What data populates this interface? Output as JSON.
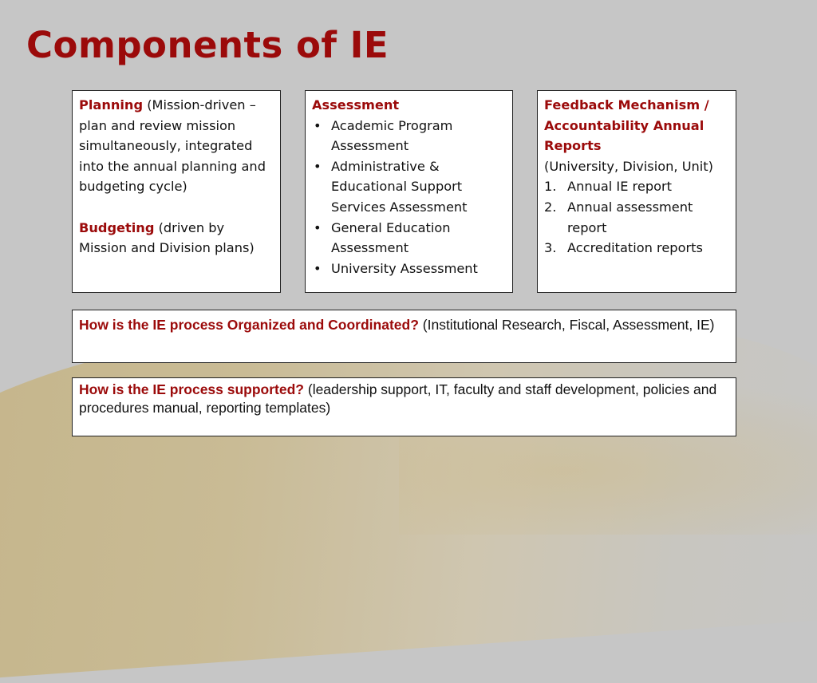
{
  "title": "Components of IE",
  "colors": {
    "accent": "#9b0a0a",
    "background": "#c6c6c6",
    "box": "#ffffff"
  },
  "planning_box": {
    "planning_heading": "Planning",
    "planning_text": " (Mission-driven – plan and review mission simultaneously, integrated into the annual planning and budgeting cycle)",
    "budgeting_heading": "Budgeting",
    "budgeting_text": " (driven by Mission and Division plans)"
  },
  "assessment_box": {
    "heading": "Assessment",
    "bullet_glyph": "•",
    "items": [
      "Academic Program Assessment",
      "Administrative & Educational Support Services  Assessment",
      "General Education Assessment",
      "University Assessment"
    ]
  },
  "feedback_box": {
    "heading": "Feedback Mechanism / Accountability Annual Reports",
    "subtext": "(University, Division, Unit)",
    "items": [
      {
        "num": "1.",
        "text": "Annual IE report"
      },
      {
        "num": "2.",
        "text": "Annual assessment report"
      },
      {
        "num": "3.",
        "text": "Accreditation reports"
      }
    ]
  },
  "organized_box": {
    "question": "How is the IE process Organized and Coordinated?",
    "answer": " (Institutional Research, Fiscal, Assessment, IE)"
  },
  "supported_box": {
    "question": "How is the IE process supported?",
    "answer": " (leadership support, IT, faculty and staff development, policies and procedures manual, reporting templates)"
  }
}
